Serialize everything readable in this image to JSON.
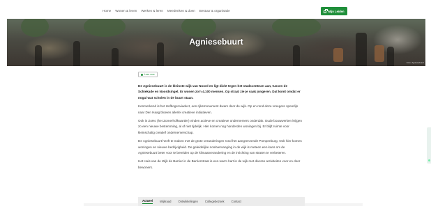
{
  "nav": {
    "links": [
      "Home",
      "Wonen & leven",
      "Werken & leren",
      "Meedenken & doen",
      "Bestuur & organisatie"
    ],
    "mijn_button": "Mijn Leiden"
  },
  "hero": {
    "title": "Agniesebuurt",
    "credit": "Foto: Agniesebuurt"
  },
  "readaloud_label": "Lees voor",
  "paragraphs": {
    "intro": "De Agniesebuurt is de kleinste wijk van Noord en ligt dicht tegen het stadscentrum aan, tussen de Schiekade en Noordsingel. Er wonen zo'n 4.100 mensen. Op straat zie je vaak jongeren. Dat komt omdat er nogal wat scholen in de buurt staan.",
    "p1": "Kenmerkend is het Hofbogenviaduct, een rijksmonument dwars door de wijk. Op en rond deze vroegere spoorlijn naar Den Haag bloeien allerlei creatieve initiatieven.",
    "p2": "Ook in ZoHo (het Zomerhofkwartier) vinden actieve en creatieve ondernemers onderdak. Oude bouwwerken krijgen zo een nieuwe bestemming, al of niet tijdelijk. Hier komen nog honderden woningen bij. Er blijft ruimte voor kleinschalig creatief ondernemerschap.",
    "p3": "De Agniesebuurt heeft te maken met de grote veranderingen rond het aangrenzende Pompenburg. Ook hier komen woningen en nieuwe bedrijvigheid. De geleidelijke nooitvervanging in de wijk is meteen een kans om de Agniesebuurt beter voor te bereiden op de klimaatverandering en de inrichting van straten te verbeteren.",
    "p4": "Het Huis van de Wijk de Barrier in de Barrierstraat is een warm hart in de wijk met diverse activiteiten voor en door bewoners."
  },
  "tabs": [
    "Actueel",
    "Wijkraad",
    "Ontwikkelingen",
    "Collegebezoek",
    "Contact"
  ],
  "colors": {
    "accent": "#1f8f3a"
  }
}
